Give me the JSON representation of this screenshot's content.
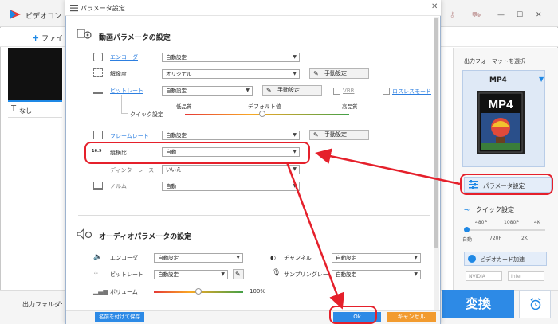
{
  "app": {
    "title": "ビデオコン",
    "add_file": "ファイ",
    "subtitle_value": "なし",
    "subtitle_t": "T",
    "output_folder_label": "出力フォルダ:",
    "output_format_label": "出力フォーマットを選択",
    "output_format": "MP4",
    "mp4_badge": "MP4",
    "param_settings": "パラメータ設定",
    "quick_settings": "クイック設定",
    "quick_top_labels": [
      "480P",
      "1080P",
      "4K"
    ],
    "quick_bottom_labels": [
      "自動",
      "720P",
      "2K"
    ],
    "gpu_accel": "ビデオカード加速",
    "nvidia": "NVIDIA",
    "intel": "Intel",
    "convert": "変換"
  },
  "dialog": {
    "title": "パラメータ設定",
    "video_section": {
      "title": "動画パラメータの設定",
      "encoder": {
        "label": "エンコーダ",
        "value": "自動設定"
      },
      "resolution": {
        "label": "解像度",
        "value": "オリジナル",
        "button": "手動設定"
      },
      "bitrate": {
        "label": "ビットレート",
        "value": "自動設定",
        "button": "手動設定",
        "vbr": "VBR",
        "lossless": "ロスレスモード"
      },
      "quick": {
        "label": "クイック設定",
        "low": "低品質",
        "default": "デフォルト値",
        "high": "高品質",
        "value": 0.47
      },
      "framerate": {
        "label": "フレームレート",
        "value": "自動設定",
        "button": "手動設定"
      },
      "aspect": {
        "label": "縦横比",
        "value": "自動"
      },
      "deinterlace": {
        "label": "ディンターレース",
        "value": "いいえ"
      },
      "norm": {
        "label": "ノルム",
        "value": "自動"
      }
    },
    "audio_section": {
      "title": "オーディオパラメータの設定",
      "encoder": {
        "label": "エンコーダ",
        "value": "自動設定"
      },
      "channel": {
        "label": "チャンネル",
        "value": "自動設定"
      },
      "bitrate": {
        "label": "ビットレート",
        "value": "自動設定"
      },
      "sampling": {
        "label": "サンプリングレー",
        "value": "自動設定"
      },
      "volume": {
        "label": "ボリューム",
        "value": "100%",
        "level": 0.5
      }
    },
    "save_as": "名前を付けて保存",
    "ok": "Ok",
    "cancel": "キャンセル"
  },
  "colors": {
    "accent": "#2d8ae6",
    "annotation": "#e5202b",
    "cancel": "#f29b2f"
  }
}
